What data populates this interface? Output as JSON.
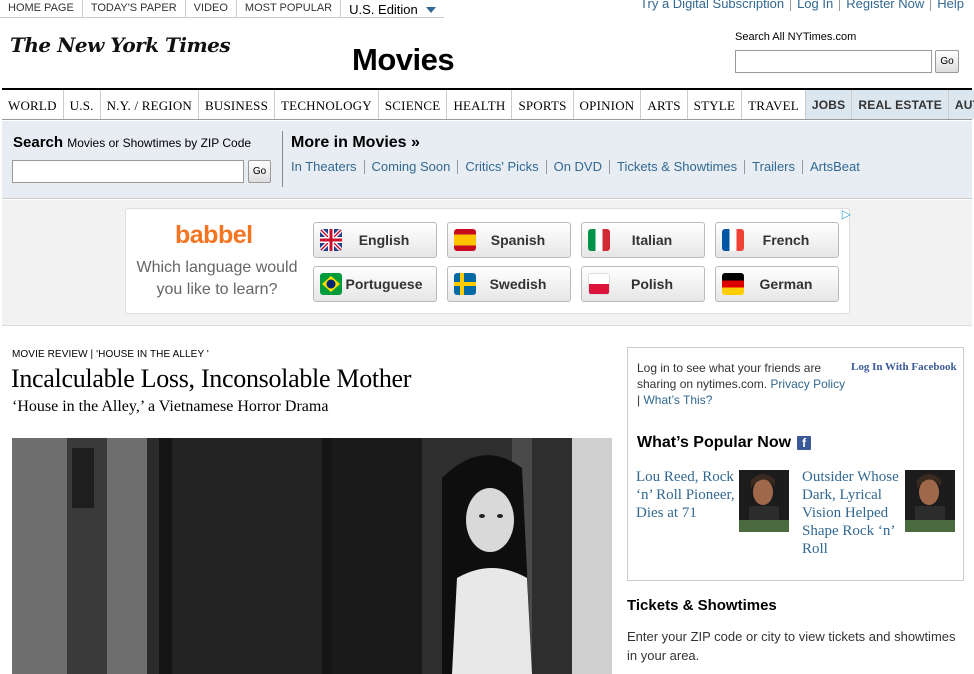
{
  "topbar": {
    "left_links": [
      "HOME PAGE",
      "TODAY'S PAPER",
      "VIDEO",
      "MOST POPULAR"
    ],
    "edition": "U.S. Edition",
    "right_links": [
      "Try a Digital Subscription",
      "Log In",
      "Register Now",
      "Help"
    ]
  },
  "masthead": {
    "logo": "The New York Times",
    "section": "Movies",
    "search_label": "Search All NYTimes.com",
    "search_placeholder": "",
    "go": "Go"
  },
  "nav": {
    "items": [
      "WORLD",
      "U.S.",
      "N.Y. / REGION",
      "BUSINESS",
      "TECHNOLOGY",
      "SCIENCE",
      "HEALTH",
      "SPORTS",
      "OPINION",
      "ARTS",
      "STYLE",
      "TRAVEL",
      "JOBS",
      "REAL ESTATE",
      "AUTOS"
    ]
  },
  "subbar": {
    "search_bold": "Search",
    "search_rest": "Movies or Showtimes by ZIP Code",
    "go": "Go",
    "more_title": "More in Movies »",
    "links": [
      "In Theaters",
      "Coming Soon",
      "Critics' Picks",
      "On DVD",
      "Tickets & Showtimes",
      "Trailers",
      "ArtsBeat"
    ]
  },
  "ad": {
    "brand": "babbel",
    "tagline": "Which language would you like to learn?",
    "languages": [
      "English",
      "Spanish",
      "Italian",
      "French",
      "Portuguese",
      "Swedish",
      "Polish",
      "German"
    ]
  },
  "article": {
    "kicker": "MOVIE REVIEW | 'HOUSE IN THE ALLEY '",
    "headline": "Incalculable Loss, Inconsolable Mother",
    "deck": "‘House in the Alley,’ a Vietnamese Horror Drama"
  },
  "rail": {
    "login_text": "Log in to see what your friends are sharing on nytimes.com.",
    "privacy_link": "Privacy Policy",
    "sep": " | ",
    "whats_this": "What’s This?",
    "fb_login": "Log In With Facebook",
    "popular_title": "What’s Popular Now",
    "fb_letter": "f",
    "stories": [
      "Lou Reed, Rock ‘n’ Roll Pioneer, Dies at 71",
      "Outsider Whose Dark, Lyrical Vision Helped Shape Rock ‘n’ Roll"
    ]
  },
  "tickets": {
    "title": "Tickets & Showtimes",
    "text": "Enter your ZIP code or city to view tickets and showtimes in your area."
  },
  "colors": {
    "link": "#326891",
    "accent_orange": "#f47521",
    "facebook": "#3b5998",
    "subbar_bg": "#e8edf3"
  }
}
